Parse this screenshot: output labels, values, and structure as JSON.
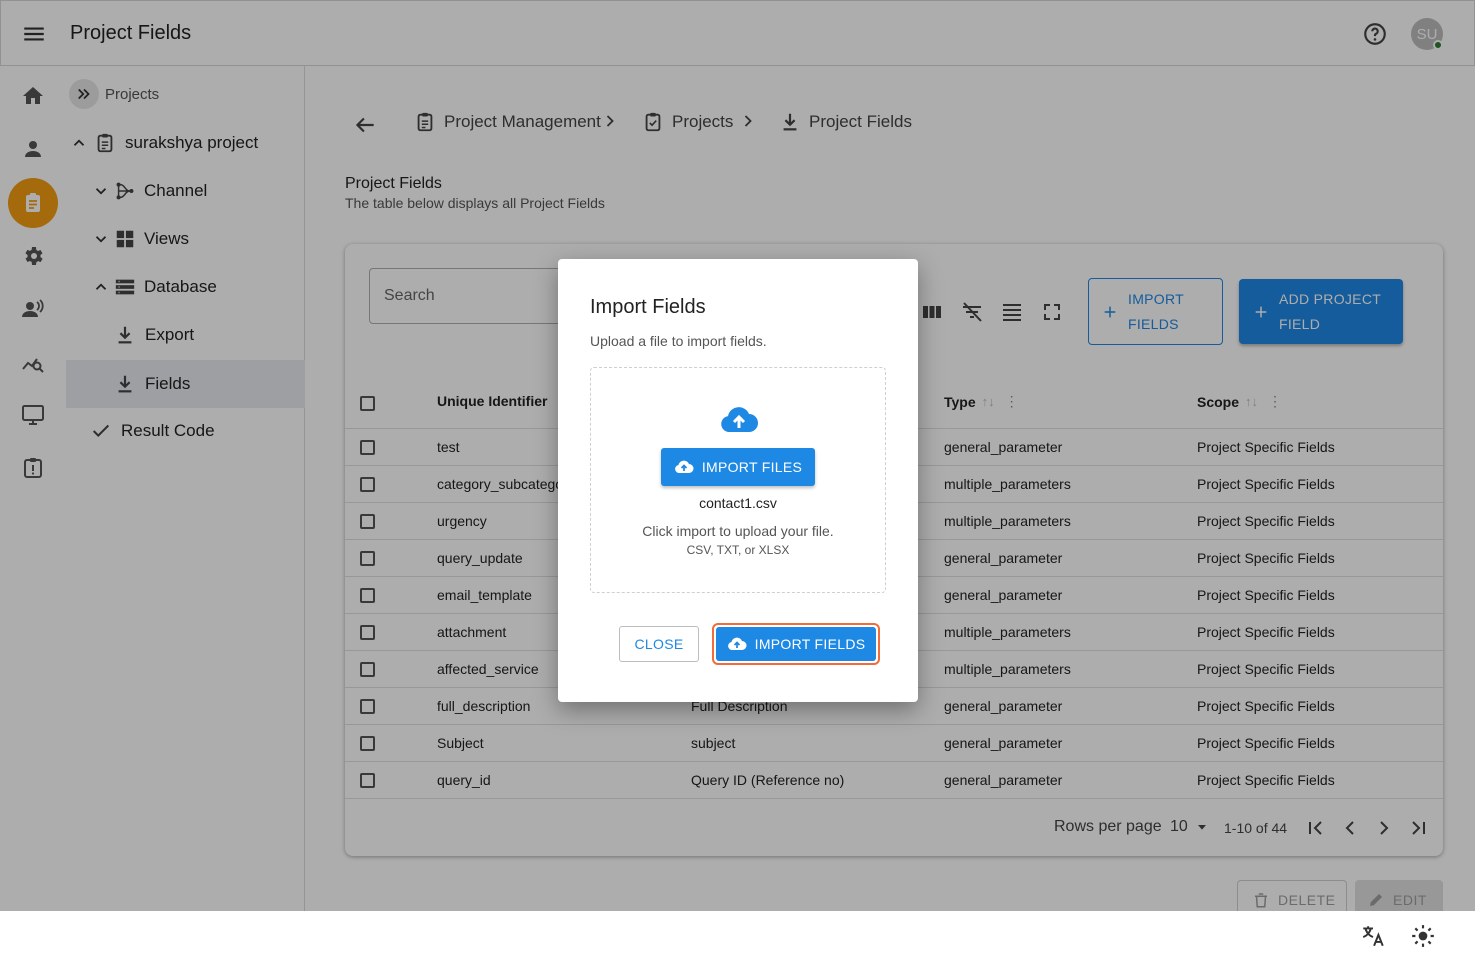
{
  "app": {
    "title": "Project Fields",
    "avatar_initials": "SU"
  },
  "tree": {
    "header": "Projects",
    "items": [
      {
        "label": "surakshya project"
      },
      {
        "label": "Channel"
      },
      {
        "label": "Views"
      },
      {
        "label": "Database"
      },
      {
        "label": "Export"
      },
      {
        "label": "Fields"
      },
      {
        "label": "Result Code"
      }
    ]
  },
  "breadcrumb": [
    {
      "label": "Project Management"
    },
    {
      "label": "Projects"
    },
    {
      "label": "Project Fields"
    }
  ],
  "section": {
    "title": "Project Fields",
    "subtitle": "The table below displays all Project Fields"
  },
  "toolbar": {
    "search_placeholder": "Search",
    "import_label_1": "IMPORT",
    "import_label_2": "FIELDS",
    "add_label_1": "ADD PROJECT",
    "add_label_2": "FIELD"
  },
  "table": {
    "headers": [
      "Unique Identifier",
      "Type",
      "Scope"
    ],
    "rows": [
      {
        "id": "test",
        "label": "",
        "type": "general_parameter",
        "scope": "Project Specific Fields"
      },
      {
        "id": "category_subcatego",
        "label": "",
        "type": "multiple_parameters",
        "scope": "Project Specific Fields"
      },
      {
        "id": "urgency",
        "label": "",
        "type": "multiple_parameters",
        "scope": "Project Specific Fields"
      },
      {
        "id": "query_update",
        "label": "",
        "type": "general_parameter",
        "scope": "Project Specific Fields"
      },
      {
        "id": "email_template",
        "label": "",
        "type": "general_parameter",
        "scope": "Project Specific Fields"
      },
      {
        "id": "attachment",
        "label": "",
        "type": "multiple_parameters",
        "scope": "Project Specific Fields"
      },
      {
        "id": "affected_service",
        "label": "",
        "type": "multiple_parameters",
        "scope": "Project Specific Fields"
      },
      {
        "id": "full_description",
        "label": "Full Description",
        "type": "general_parameter",
        "scope": "Project Specific Fields"
      },
      {
        "id": "Subject",
        "label": "subject",
        "type": "general_parameter",
        "scope": "Project Specific Fields"
      },
      {
        "id": "query_id",
        "label": "Query ID (Reference no)",
        "type": "general_parameter",
        "scope": "Project Specific Fields"
      }
    ]
  },
  "pagination": {
    "rows_per_page_label": "Rows per page",
    "rows_per_page": "10",
    "range": "1-10 of 44"
  },
  "actions": {
    "delete": "DELETE",
    "edit": "EDIT"
  },
  "dialog": {
    "title": "Import Fields",
    "subtitle": "Upload a file to import fields.",
    "upload_button": "IMPORT FILES",
    "file_name": "contact1.csv",
    "hint": "Click import to upload your file.",
    "types": "CSV, TXT, or XLSX",
    "close": "CLOSE",
    "submit": "IMPORT FIELDS"
  },
  "colors": {
    "accent": "#1e88e5",
    "rail_active": "#f39c12",
    "focus_ring": "#f26b3a"
  }
}
